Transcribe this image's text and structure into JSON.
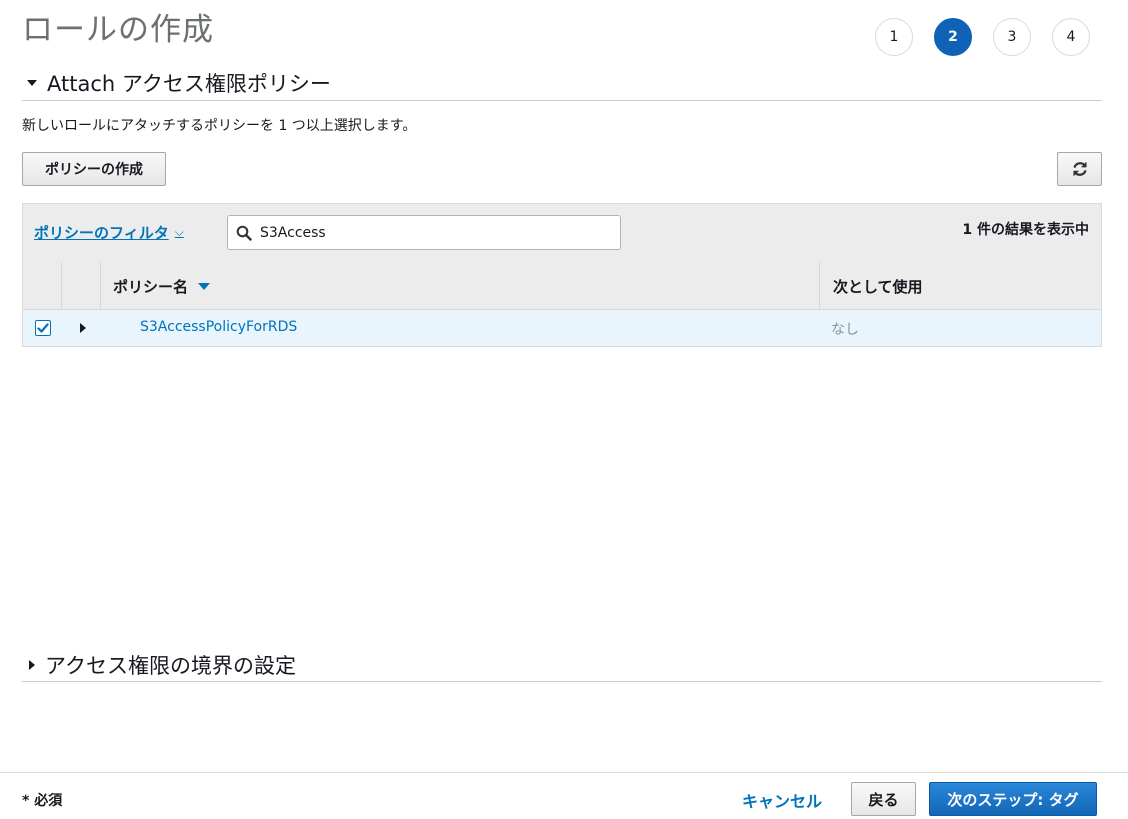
{
  "page": {
    "title": "ロールの作成"
  },
  "steps": [
    "1",
    "2",
    "3",
    "4"
  ],
  "active_step": "2",
  "attach_section": {
    "title": "Attach アクセス権限ポリシー",
    "description": "新しいロールにアタッチするポリシーを 1 つ以上選択します。",
    "create_policy_label": "ポリシーの作成",
    "refresh_icon": "refresh-icon"
  },
  "filter": {
    "label": "ポリシーのフィルタ",
    "search_value": "S3Access",
    "search_icon": "search-icon",
    "results_text": "1 件の結果を表示中"
  },
  "table": {
    "columns": {
      "policy_name": "ポリシー名",
      "used_as": "次として使用"
    },
    "rows": [
      {
        "checked": true,
        "name": "S3AccessPolicyForRDS",
        "used_as": "なし"
      }
    ]
  },
  "boundary_section": {
    "title": "アクセス権限の境界の設定"
  },
  "footer": {
    "required_label": "* 必須",
    "cancel_label": "キャンセル",
    "back_label": "戻る",
    "next_label": "次のステップ: タグ"
  },
  "colors": {
    "primary": "#0f62b6",
    "link": "#0073bb",
    "selected_row": "#e9f5fc",
    "header_bg": "#ececec"
  }
}
